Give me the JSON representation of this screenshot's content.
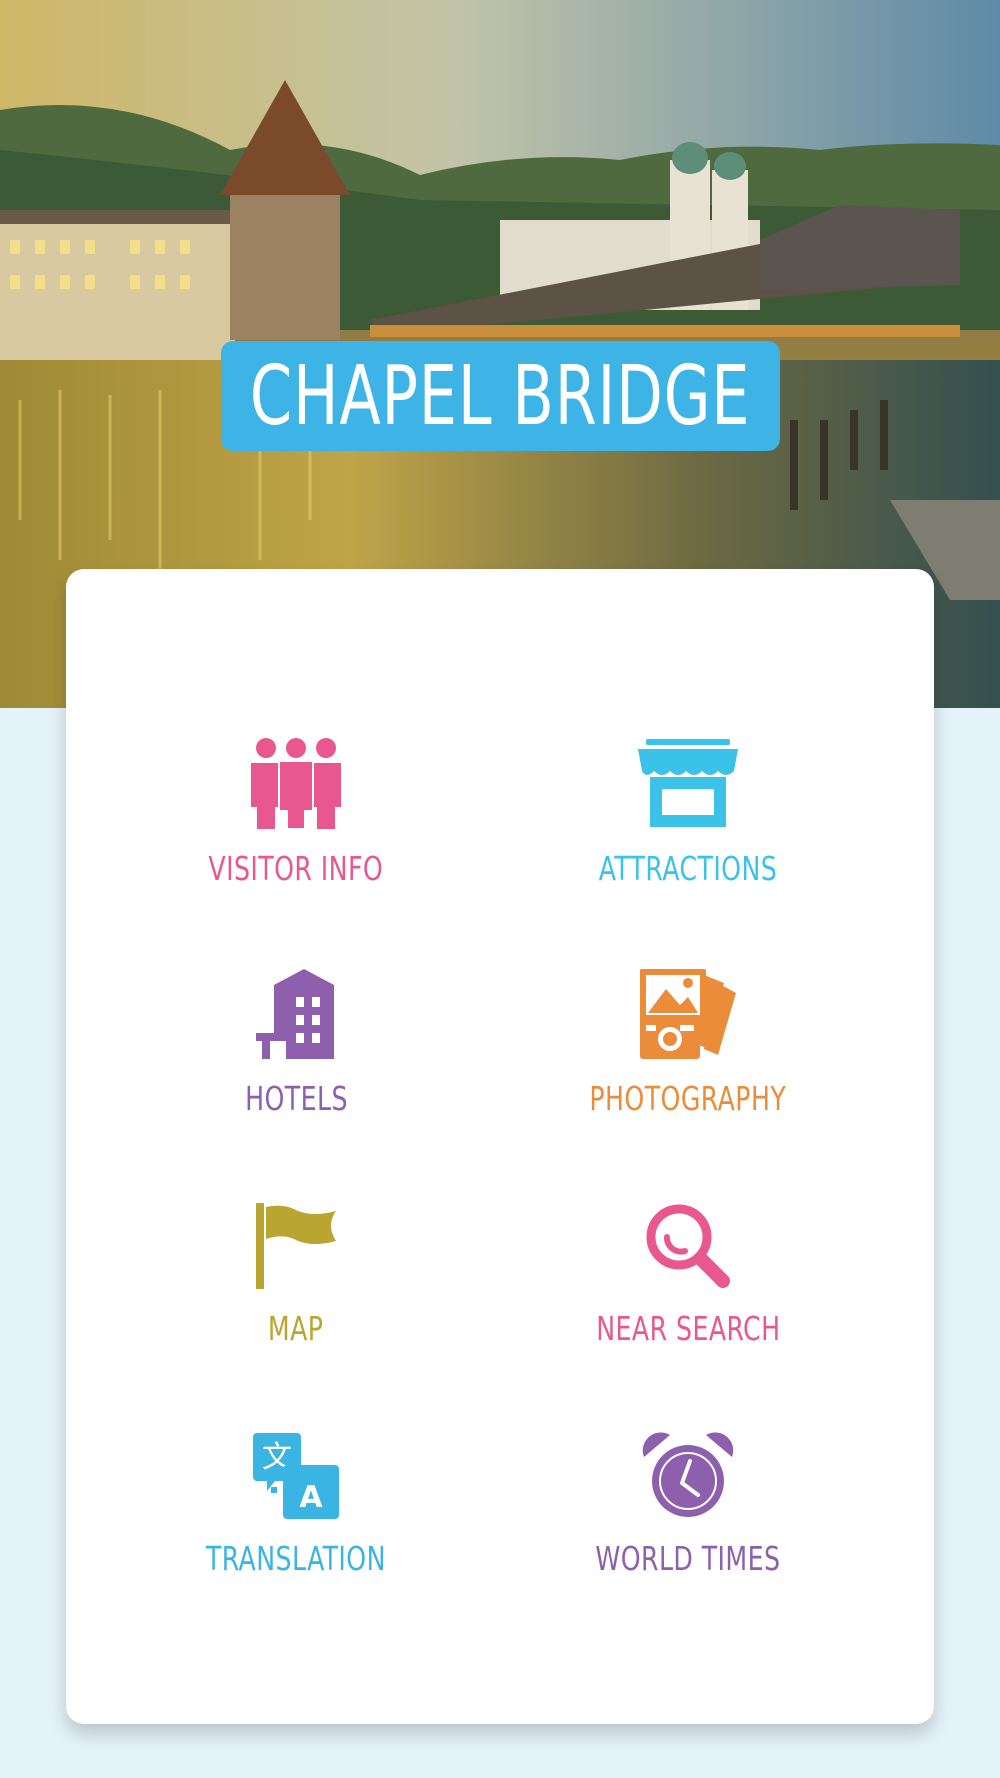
{
  "header": {
    "title": "CHAPEL BRIDGE",
    "title_bg": "#3db3e6"
  },
  "menu": {
    "items": [
      {
        "label": "VISITOR INFO",
        "icon": "people-icon",
        "color": "#e8588f"
      },
      {
        "label": "ATTRACTIONS",
        "icon": "shop-icon",
        "color": "#3ac2e8"
      },
      {
        "label": "HOTELS",
        "icon": "hotel-building-icon",
        "color": "#8e5fad"
      },
      {
        "label": "PHOTOGRAPHY",
        "icon": "camera-photos-icon",
        "color": "#ea8c3a"
      },
      {
        "label": "MAP",
        "icon": "flag-icon",
        "color": "#b9a52f"
      },
      {
        "label": "NEAR SEARCH",
        "icon": "magnifier-icon",
        "color": "#e8588f"
      },
      {
        "label": "TRANSLATION",
        "icon": "translate-icon",
        "color": "#3ab4e2"
      },
      {
        "label": "WORLD TIMES",
        "icon": "alarm-clock-icon",
        "color": "#8e5fad"
      }
    ]
  }
}
